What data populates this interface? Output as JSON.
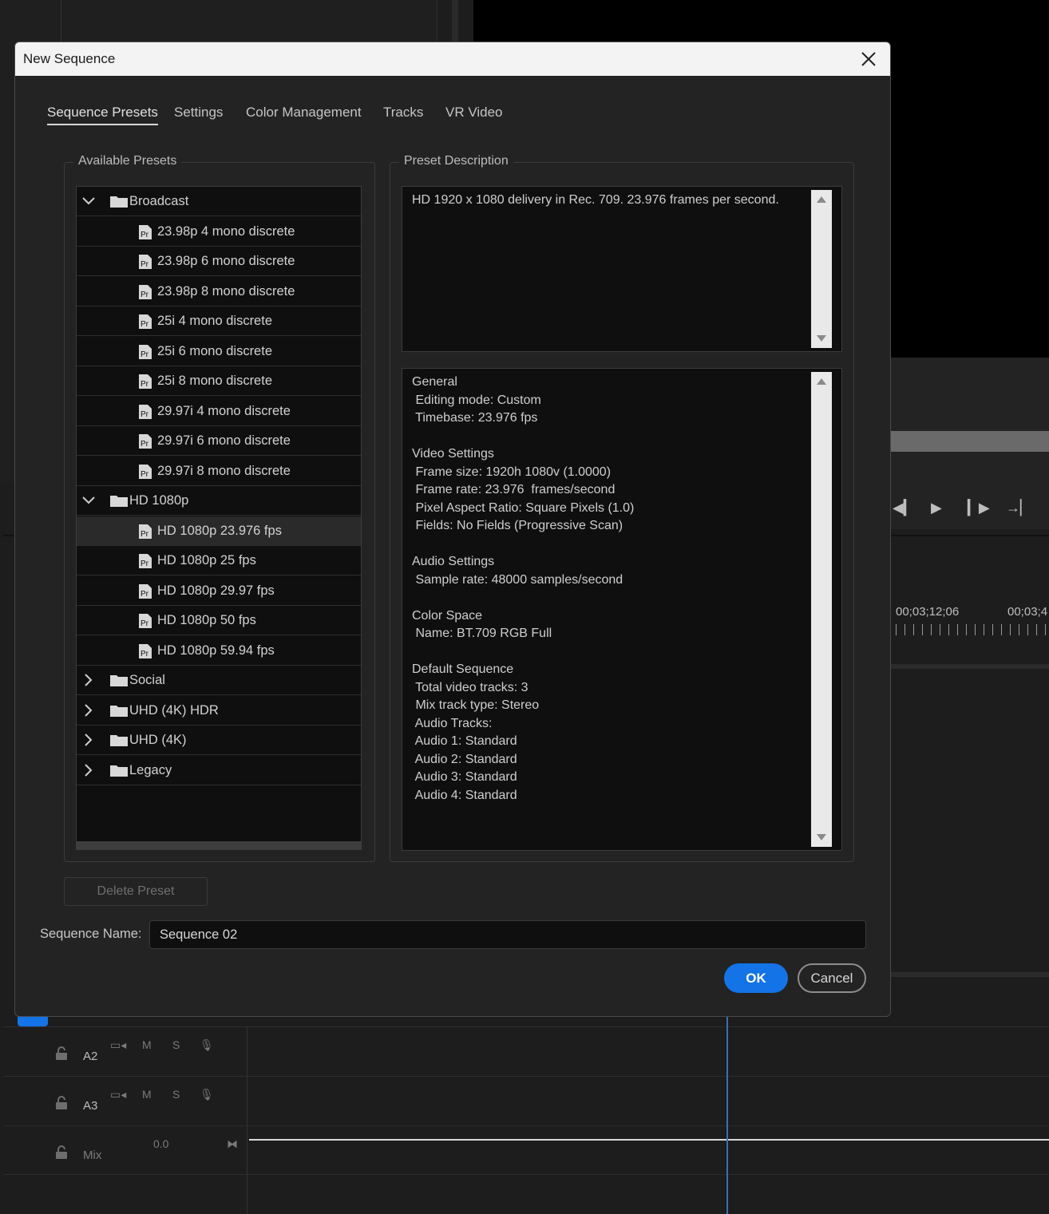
{
  "dialog": {
    "title": "New Sequence",
    "tabs": [
      "Sequence Presets",
      "Settings",
      "Color Management",
      "Tracks",
      "VR Video"
    ],
    "active_tab": "Sequence Presets",
    "available_presets_label": "Available Presets",
    "preset_description_label": "Preset Description",
    "tree": [
      {
        "type": "folder",
        "label": "Broadcast",
        "expanded": true
      },
      {
        "type": "preset",
        "label": "23.98p 4 mono discrete"
      },
      {
        "type": "preset",
        "label": "23.98p 6 mono discrete"
      },
      {
        "type": "preset",
        "label": "23.98p 8 mono discrete"
      },
      {
        "type": "preset",
        "label": "25i 4 mono discrete"
      },
      {
        "type": "preset",
        "label": "25i 6 mono discrete"
      },
      {
        "type": "preset",
        "label": "25i 8 mono discrete"
      },
      {
        "type": "preset",
        "label": "29.97i 4 mono discrete"
      },
      {
        "type": "preset",
        "label": "29.97i 6 mono discrete"
      },
      {
        "type": "preset",
        "label": "29.97i 8 mono discrete"
      },
      {
        "type": "folder",
        "label": "HD 1080p",
        "expanded": true
      },
      {
        "type": "preset",
        "label": "HD 1080p 23.976 fps",
        "selected": true
      },
      {
        "type": "preset",
        "label": "HD 1080p 25 fps"
      },
      {
        "type": "preset",
        "label": "HD 1080p 29.97 fps"
      },
      {
        "type": "preset",
        "label": "HD 1080p 50 fps"
      },
      {
        "type": "preset",
        "label": "HD 1080p 59.94 fps"
      },
      {
        "type": "folder",
        "label": "Social",
        "expanded": false
      },
      {
        "type": "folder",
        "label": "UHD (4K) HDR",
        "expanded": false
      },
      {
        "type": "folder",
        "label": "UHD (4K)",
        "expanded": false
      },
      {
        "type": "folder",
        "label": "Legacy",
        "expanded": false
      }
    ],
    "description": "HD 1920 x 1080 delivery in Rec. 709. 23.976 frames per second.",
    "details": "General\n Editing mode: Custom\n Timebase: 23.976 fps\n\nVideo Settings\n Frame size: 1920h 1080v (1.0000)\n Frame rate: 23.976  frames/second\n Pixel Aspect Ratio: Square Pixels (1.0)\n Fields: No Fields (Progressive Scan)\n\nAudio Settings\n Sample rate: 48000 samples/second\n\nColor Space\n Name: BT.709 RGB Full\n\nDefault Sequence\n Total video tracks: 3\n Mix track type: Stereo\n Audio Tracks:\n Audio 1: Standard\n Audio 2: Standard\n Audio 3: Standard\n Audio 4: Standard",
    "delete_preset_label": "Delete Preset",
    "sequence_name_label": "Sequence Name:",
    "sequence_name_value": "Sequence 02",
    "ok_label": "OK",
    "cancel_label": "Cancel"
  },
  "background": {
    "timecodes": [
      "00;03;12;06",
      "00;03;4"
    ],
    "tracks": [
      {
        "label": "A2",
        "m": "M",
        "s": "S"
      },
      {
        "label": "A3",
        "m": "M",
        "s": "S"
      },
      {
        "label": "Mix",
        "value": "0.0"
      }
    ]
  },
  "colors": {
    "accent": "#1473e6",
    "playhead": "#3b6fb6"
  }
}
